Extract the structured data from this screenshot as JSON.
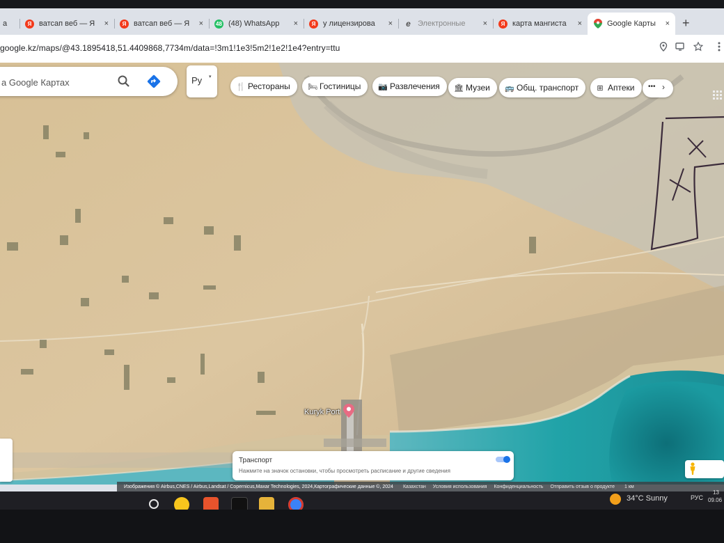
{
  "browser": {
    "tabs": [
      {
        "label": "а",
        "favicon": "generic-icon",
        "active": false,
        "closable": false
      },
      {
        "label": "ватсап веб — Я",
        "favicon": "yandex-icon",
        "active": false,
        "closable": true
      },
      {
        "label": "ватсап веб — Я",
        "favicon": "yandex-icon",
        "active": false,
        "closable": true
      },
      {
        "label": "(48) WhatsApp",
        "favicon": "whatsapp-icon",
        "badge": "48",
        "active": false,
        "closable": true
      },
      {
        "label": "у лицензирова",
        "favicon": "yandex-icon",
        "active": false,
        "closable": true
      },
      {
        "label": "Электронные",
        "favicon": "egov-icon",
        "active": false,
        "closable": true
      },
      {
        "label": "карта мангиста",
        "favicon": "yandex-icon",
        "active": false,
        "closable": true
      },
      {
        "label": "Google Карты",
        "favicon": "google-maps-icon",
        "active": true,
        "closable": true
      }
    ],
    "close_glyph": "×",
    "new_tab_glyph": "+",
    "yandex_letter": "Я",
    "egov_letter": "e",
    "url": "google.kz/maps/@43.1895418,51.4409868,7734m/data=!3m1!1e3!5m2!1e2!1e4?entry=ttu"
  },
  "maps": {
    "search_placeholder": "а Google Картах",
    "layer_select_value": "Ру",
    "layer_select_arrow": "▾",
    "chips": [
      {
        "label": "Рестораны",
        "icon": "fork-knife-icon",
        "glyph": "🍴"
      },
      {
        "label": "Гостиницы",
        "icon": "bed-icon",
        "glyph": "🛏"
      },
      {
        "label": "Развлечения",
        "icon": "camera-icon",
        "glyph": "📷"
      },
      {
        "label": "Музеи",
        "icon": "museum-icon",
        "glyph": "🏛"
      },
      {
        "label": "Общ. транспорт",
        "icon": "bus-icon",
        "glyph": "🚌"
      },
      {
        "label": "Аптеки",
        "icon": "pharmacy-icon",
        "glyph": "⊞"
      }
    ],
    "chips_more_dots": "•••",
    "chips_more_arrow": "›",
    "place_label": "Kuryk Port",
    "transport_card": {
      "title": "Транспорт",
      "description": "Нажмите на значок остановки, чтобы просмотреть расписание и другие сведения"
    },
    "attribution": {
      "imagery": "Изображения © Airbus,CNES / Airbus,Landsat / Copernicus,Maxar Technologies, 2024,Картографические данные ©, 2024",
      "country": "Казахстан",
      "terms": "Условия использования",
      "privacy": "Конфиденциальность",
      "feedback": "Отправить отзыв о продукте",
      "scale": "1 км"
    }
  },
  "taskbar": {
    "weather": "34°C  Sunny",
    "language": "РУС",
    "time": "13",
    "date": "09.06"
  },
  "colors": {
    "sea": "#1fa0a0",
    "sand": "#d8c29a",
    "accent": "#1a73e8"
  }
}
